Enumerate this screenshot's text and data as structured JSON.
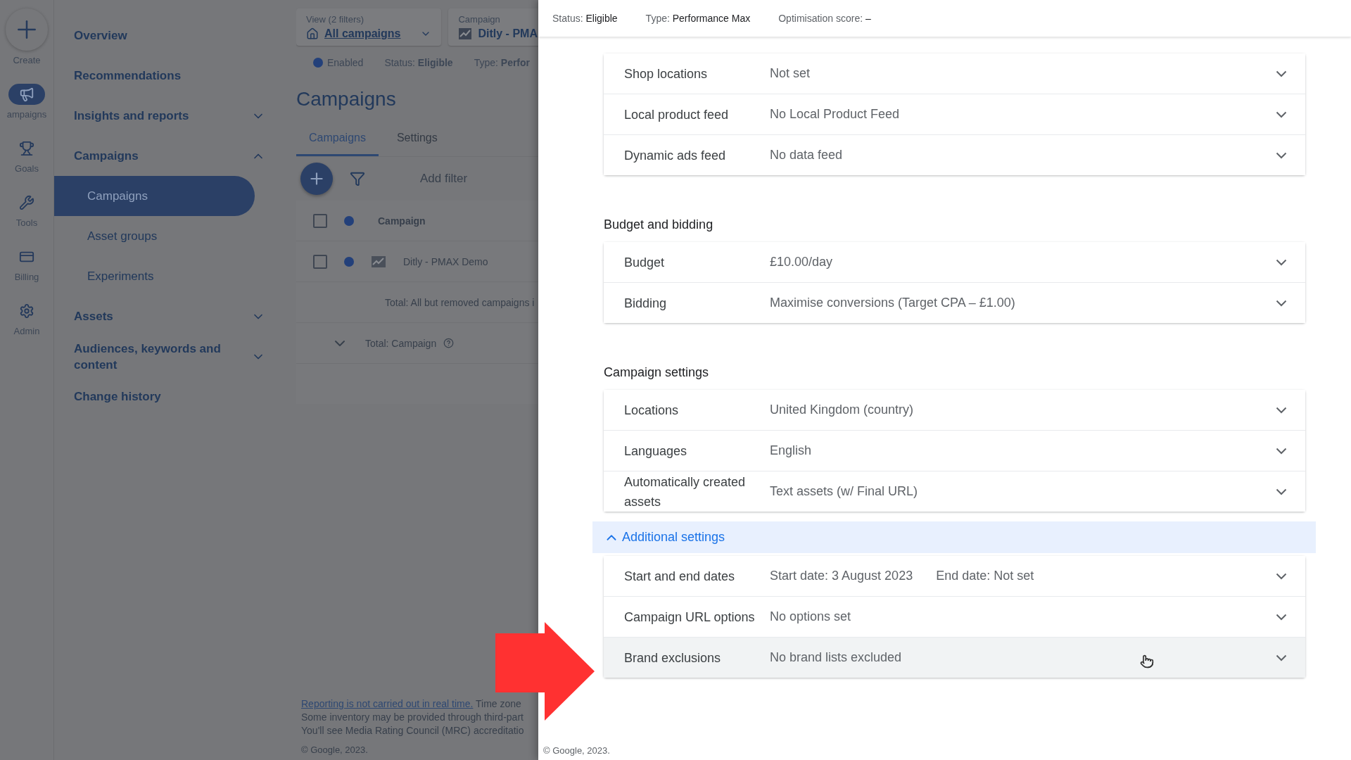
{
  "rail": [
    {
      "label": "Create",
      "selected": false
    },
    {
      "label": "ampaigns",
      "selected": true
    },
    {
      "label": "Goals",
      "selected": false
    },
    {
      "label": "Tools",
      "selected": false
    },
    {
      "label": "Billing",
      "selected": false
    },
    {
      "label": "Admin",
      "selected": false
    }
  ],
  "nav": [
    {
      "label": "Overview"
    },
    {
      "label": "Recommendations"
    },
    {
      "label": "Insights and reports",
      "expanded": false
    },
    {
      "label": "Campaigns",
      "expanded": true,
      "children": [
        {
          "label": "Campaigns",
          "selected": true
        },
        {
          "label": "Asset groups",
          "selected": false
        },
        {
          "label": "Experiments",
          "selected": false
        }
      ]
    },
    {
      "label": "Assets",
      "expanded": false
    },
    {
      "label": "Audiences, keywords and content",
      "expanded": false
    },
    {
      "label": "Change history"
    }
  ],
  "view_selector": {
    "label": "View (2 filters)",
    "value": "All campaigns"
  },
  "campaign_selector": {
    "label": "Campaign",
    "value": "Ditly - PMA"
  },
  "status_line": {
    "state": "Enabled",
    "status": "Status: **Eligible**",
    "type": "Type: **Perfor**"
  },
  "page_title": "Campaigns",
  "tabs": [
    {
      "label": "Campaigns",
      "selected": true
    },
    {
      "label": "Settings",
      "selected": false
    }
  ],
  "toolbar": {
    "filter_label": "Add filter"
  },
  "table": {
    "header": "Campaign",
    "select_all_checked": false,
    "rows": [
      {
        "name": "Ditly - PMAX Demo",
        "checked": false
      }
    ],
    "total_all": "Total: All but removed campaigns i",
    "total_campaign": "Total: Campaign"
  },
  "footer_left": {
    "link": "Reporting is not carried out in real time.",
    "rest": "Time zone",
    "lines": [
      "Some inventory may be provided through third-part",
      "You'll see Media Rating Council (MRC) accreditatio"
    ],
    "copyright": "© Google, 2023."
  },
  "panel": {
    "header": [
      "Status: **Eligible**",
      "Type: **Performance Max**",
      "Optimisation score: **–**"
    ],
    "sections": [
      {
        "rows": [
          {
            "label": "Shop locations",
            "values": [
              "Not set"
            ],
            "hovered": false
          },
          {
            "label": "Local product feed",
            "values": [
              "No Local Product Feed"
            ],
            "hovered": false
          },
          {
            "label": "Dynamic ads feed",
            "values": [
              "No data feed"
            ],
            "hovered": false
          }
        ]
      },
      {
        "title": "Budget and bidding",
        "rows": [
          {
            "label": "Budget",
            "values": [
              "£10.00/day"
            ],
            "hovered": false
          },
          {
            "label": "Bidding",
            "values": [
              "Maximise conversions (Target CPA – £1.00)"
            ],
            "hovered": false
          }
        ]
      },
      {
        "title": "Campaign settings",
        "rows": [
          {
            "label": "Locations",
            "values": [
              "United Kingdom (country)"
            ],
            "hovered": false
          },
          {
            "label": "Languages",
            "values": [
              "English"
            ],
            "hovered": false
          },
          {
            "label": "Automatically created assets",
            "values": [
              "Text assets (w/ Final URL)"
            ],
            "hovered": false
          }
        ]
      },
      {
        "toggle": "Additional settings",
        "expanded": true,
        "rows": [
          {
            "label": "Start and end dates",
            "values": [
              "Start date: 3 August 2023",
              "End date: Not set"
            ],
            "hovered": false
          },
          {
            "label": "Campaign URL options",
            "values": [
              "No options set"
            ],
            "hovered": false
          },
          {
            "label": "Brand exclusions",
            "values": [
              "No brand lists excluded"
            ],
            "hovered": true
          }
        ]
      }
    ],
    "copyright": "© Google, 2023."
  }
}
